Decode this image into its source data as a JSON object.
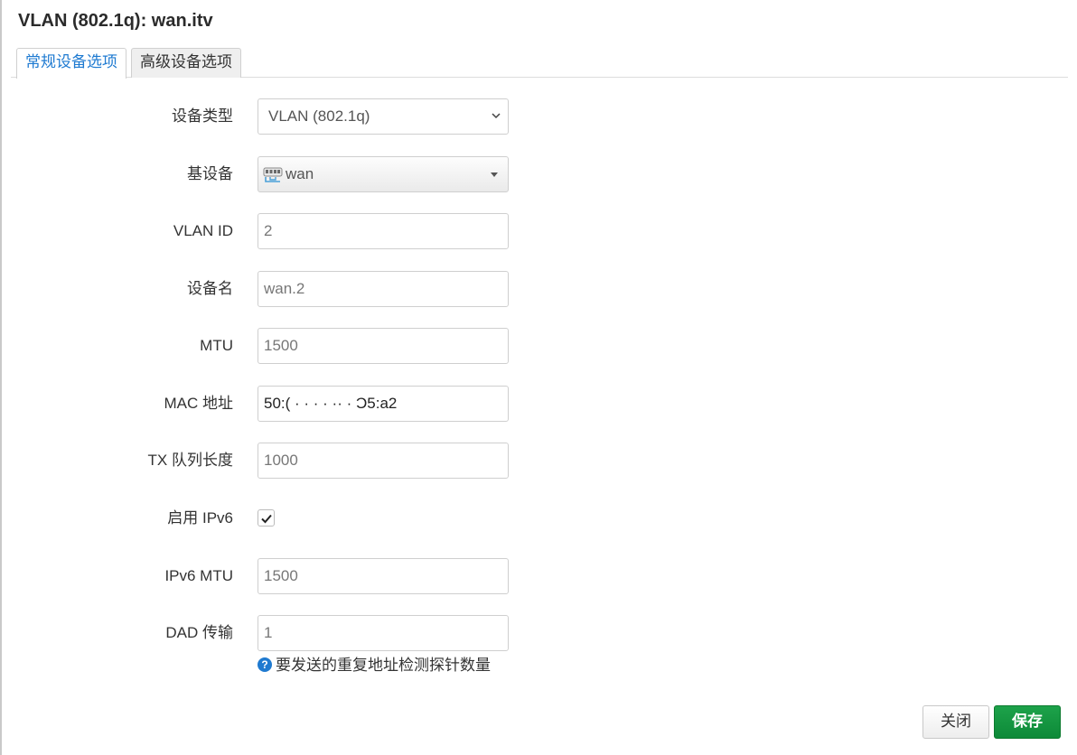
{
  "dialog": {
    "title": "VLAN (802.1q): wan.itv"
  },
  "tabs": [
    {
      "label": "常规设备选项",
      "active": true
    },
    {
      "label": "高级设备选项",
      "active": false
    }
  ],
  "form": {
    "device_type": {
      "label": "设备类型",
      "value": "VLAN (802.1q)"
    },
    "base_device": {
      "label": "基设备",
      "value": "wan",
      "icon": "ethernet-switch-icon"
    },
    "vlan_id": {
      "label": "VLAN ID",
      "value": "2"
    },
    "device_name": {
      "label": "设备名",
      "value": "wan.2"
    },
    "mtu": {
      "label": "MTU",
      "value": "1500"
    },
    "mac": {
      "label": "MAC 地址",
      "value": "50:(  ·  ·  ·  ·  ··  ·  Ɔ5:a2"
    },
    "txqueuelen": {
      "label": "TX 队列长度",
      "value": "1000"
    },
    "ipv6": {
      "label": "启用 IPv6",
      "checked": true
    },
    "ipv6_mtu": {
      "label": "IPv6 MTU",
      "value": "1500"
    },
    "dad": {
      "label": "DAD 传输",
      "value": "1",
      "help": "要发送的重复地址检测探针数量"
    }
  },
  "buttons": {
    "close": "关闭",
    "save": "保存"
  },
  "colors": {
    "accent": "#1e7ad1",
    "save": "#149240"
  }
}
